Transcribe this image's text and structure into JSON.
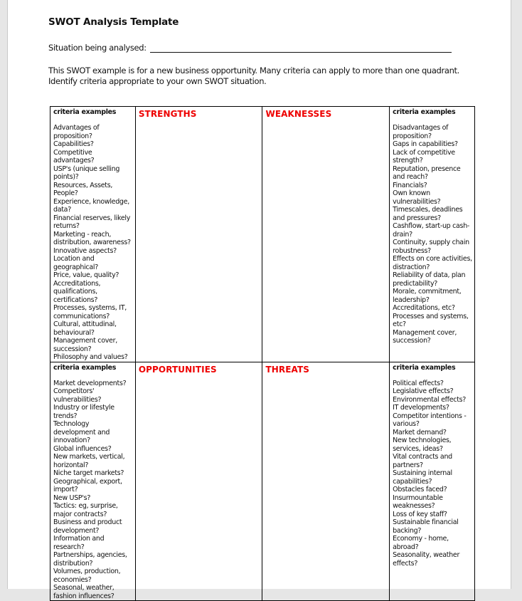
{
  "document": {
    "title": "SWOT Analysis Template",
    "situation_label": "Situation being analysed:",
    "situation_value": "",
    "intro": "This SWOT example is for a new business opportunity. Many criteria can apply to more than one quadrant. Identify criteria appropriate to your own SWOT situation."
  },
  "colors": {
    "quadrant_heading": "#ee0000",
    "background": "#e6e6e6",
    "page": "#ffffff"
  },
  "swot": {
    "strengths": {
      "criteria_heading": "criteria examples",
      "heading": "STRENGTHS",
      "content": "",
      "criteria": [
        "Advantages of proposition?",
        "Capabilities?",
        "Competitive advantages?",
        "USP's (unique selling points)?",
        "Resources, Assets, People?",
        "Experience, knowledge, data?",
        "Financial reserves, likely returns?",
        "Marketing - reach, distribution, awareness?",
        "Innovative aspects?",
        "Location and geographical?",
        "Price, value, quality?",
        "Accreditations, qualifications, certifications?",
        "Processes, systems, IT, communications?",
        "Cultural, attitudinal, behavioural?",
        "Management cover, succession?",
        "Philosophy and values?"
      ]
    },
    "weaknesses": {
      "criteria_heading": "criteria examples",
      "heading": "WEAKNESSES",
      "content": "",
      "criteria": [
        "Disadvantages of proposition?",
        "Gaps in capabilities?",
        "Lack of competitive strength?",
        "Reputation, presence and reach?",
        "Financials?",
        "Own known vulnerabilities?",
        "Timescales, deadlines and pressures?",
        "Cashflow, start-up cash-drain?",
        "Continuity, supply chain robustness?",
        "Effects on core activities, distraction?",
        "Reliability of data, plan predictability?",
        "Morale, commitment, leadership?",
        "Accreditations, etc?",
        "Processes and systems, etc?",
        "Management cover, succession?"
      ]
    },
    "opportunities": {
      "criteria_heading": "criteria examples",
      "heading": "OPPORTUNITIES",
      "content": "",
      "criteria": [
        "Market developments?",
        "Competitors' vulnerabilities?",
        "Industry or lifestyle trends?",
        "Technology development and innovation?",
        "Global influences?",
        "New markets, vertical, horizontal?",
        "Niche target markets?",
        "Geographical, export, import?",
        "New USP's?",
        "Tactics: eg, surprise, major contracts?",
        "Business and product development?",
        "Information and research?",
        "Partnerships, agencies, distribution?",
        "Volumes, production, economies?",
        "Seasonal, weather, fashion influences?"
      ]
    },
    "threats": {
      "criteria_heading": "criteria examples",
      "heading": "THREATS",
      "content": "",
      "criteria": [
        "Political effects?",
        "Legislative effects?",
        "Environmental effects?",
        "IT developments?",
        "Competitor intentions - various?",
        "Market demand?",
        "New technologies, services, ideas?",
        "Vital contracts and partners?",
        "Sustaining internal capabilities?",
        "Obstacles faced?",
        "Insurmountable weaknesses?",
        "Loss of key staff?",
        "Sustainable financial backing?",
        "Economy - home, abroad?",
        "Seasonality, weather effects?"
      ]
    }
  }
}
